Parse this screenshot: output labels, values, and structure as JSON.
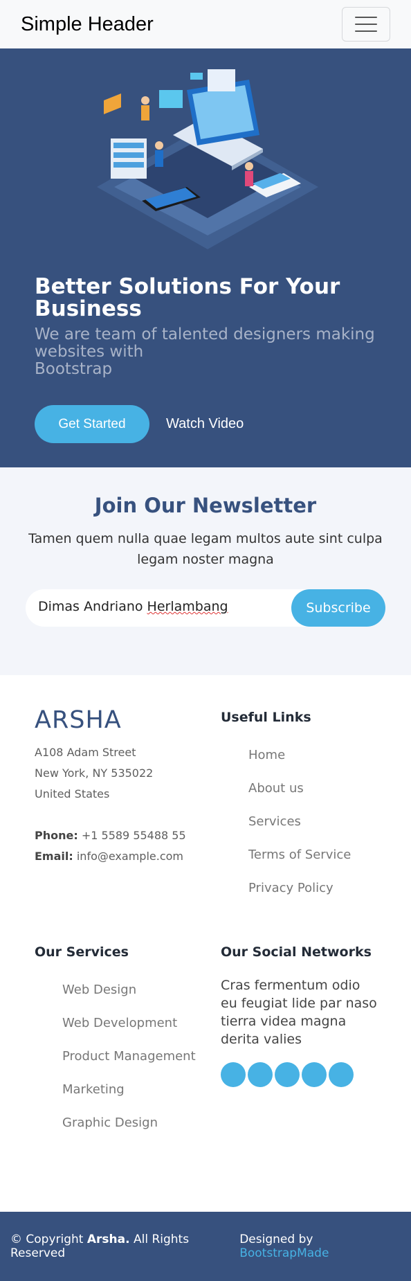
{
  "header": {
    "brand": "Simple Header",
    "menu_icon": "hamburger-icon"
  },
  "hero": {
    "title": "Better Solutions For Your Business",
    "subtitle_line1": "We are team of talented designers making websites with",
    "subtitle_line2": "Bootstrap",
    "cta_primary": "Get Started",
    "cta_secondary": "Watch Video"
  },
  "newsletter": {
    "title": "Join Our Newsletter",
    "text": "Tamen quem nulla quae legam multos aute sint culpa legam noster magna",
    "input_value_a": "Dimas Andriano ",
    "input_value_b": "Herlambang",
    "button": "Subscribe"
  },
  "footer": {
    "logo": "ARSHA",
    "address": [
      "A108 Adam Street",
      "New York, NY 535022",
      "United States"
    ],
    "phone_label": "Phone:",
    "phone": "+1 5589 55488 55",
    "email_label": "Email:",
    "email": "info@example.com",
    "useful_title": "Useful Links",
    "useful_links": [
      "Home",
      "About us",
      "Services",
      "Terms of Service",
      "Privacy Policy"
    ],
    "services_title": "Our Services",
    "services": [
      "Web Design",
      "Web Development",
      "Product Management",
      "Marketing",
      "Graphic Design"
    ],
    "social_title": "Our Social Networks",
    "social_text": "Cras fermentum odio eu feugiat lide par naso tierra videa magna derita valies",
    "social_icons": [
      "social-icon-1",
      "social-icon-2",
      "social-icon-3",
      "social-icon-4",
      "social-icon-5"
    ]
  },
  "bottom": {
    "copyright_prefix": "© Copyright ",
    "copyright_brand": "Arsha.",
    "copyright_suffix": " All Rights Reserved",
    "designed_prefix": "Designed by ",
    "designed_link": "BootstrapMade"
  },
  "colors": {
    "primary": "#37517e",
    "accent": "#47b2e4"
  }
}
